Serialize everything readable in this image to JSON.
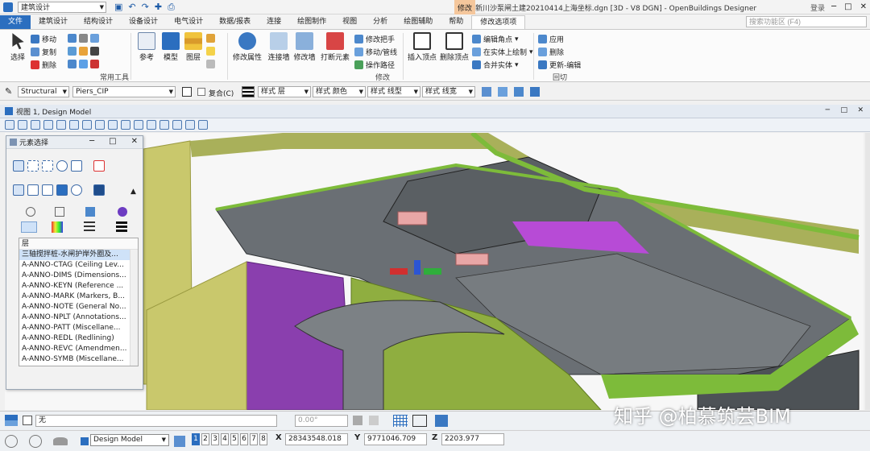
{
  "titlebar": {
    "workspace": "建筑设计",
    "context_tab": "修改",
    "document_title": "新川沙泵闸土建20210414上海坐标.dgn [3D - V8 DGN] - OpenBuildings Designer",
    "login": "登录",
    "minimize": "─",
    "maximize": "□",
    "close": "✕"
  },
  "tabs": [
    "文件",
    "建筑设计",
    "结构设计",
    "设备设计",
    "电气设计",
    "数据/报表",
    "连接",
    "绘图制作",
    "视图",
    "分析",
    "绘图辅助",
    "帮助",
    "修改选项项"
  ],
  "search": {
    "placeholder": "搜索功能区 (F4)"
  },
  "ribbon": {
    "select": "选择",
    "move": "移动",
    "copy": "复制",
    "delete": "删除",
    "common_tools": "常用工具",
    "reference": "参考",
    "model": "模型",
    "layer": "图层",
    "modify_attributes": "修改属性",
    "join_walls": "连接墙",
    "modify_wall": "修改墙",
    "break_element": "打断元素",
    "modify_handle": "修改把手",
    "move_handle": "移动/管线",
    "op_path": "操作路径",
    "modify_group": "修改",
    "insert_vertex": "插入顶点",
    "delete_vertex": "删除顶点",
    "edit_corner": "编辑角点",
    "draw_on_entity": "在实体上绘制",
    "merge_entity": "合并实体",
    "apply": "应用",
    "remove": "删除",
    "update_edit": "更新-编辑",
    "rollback": "回切"
  },
  "attrbar": {
    "family": "Structural",
    "part": "Piers_CIP",
    "overlay_label": "复合(C)",
    "layer_style": "样式 层",
    "color_style": "样式 颜色",
    "linetype_style": "样式 线型",
    "lineweight_style": "样式 线宽"
  },
  "view": {
    "title": "视图 1, Design Model"
  },
  "panel": {
    "title": "元素选择",
    "layer_header": "层",
    "layers": [
      "三轴搅拌桩-水闸护岸外圈及...",
      "A-ANNO-CTAG (Ceiling Lev...",
      "A-ANNO-DIMS (Dimensions...",
      "A-ANNO-KEYN (Reference ...",
      "A-ANNO-MARK (Markers, B...",
      "A-ANNO-NOTE (General No...",
      "A-ANNO-NPLT (Annotations...",
      "A-ANNO-PATT (Miscellane...",
      "A-ANNO-REDL (Redlining)",
      "A-ANNO-REVC (Amendmen...",
      "A-ANNO-SYMB (Miscellane..."
    ]
  },
  "status1": {
    "active_level": "无",
    "angle": "0.00°"
  },
  "status2": {
    "model": "Design Model",
    "pages": [
      "1",
      "2",
      "3",
      "4",
      "5",
      "6",
      "7",
      "8"
    ],
    "active_page": 1,
    "x_label": "X",
    "x_value": "28343548.018",
    "y_label": "Y",
    "y_value": "9771046.709",
    "z_label": "Z",
    "z_value": "2203.977"
  },
  "watermark": "知乎 @柏慕筑芸BIM",
  "colors": {
    "accent": "#2b6ebf",
    "context_tab": "#f5c79c",
    "model_wall_yellow": "#c9c86c",
    "model_wall_purple": "#8a3fae",
    "model_slab_grey": "#6a6f74",
    "model_green": "#7dbb3a"
  }
}
